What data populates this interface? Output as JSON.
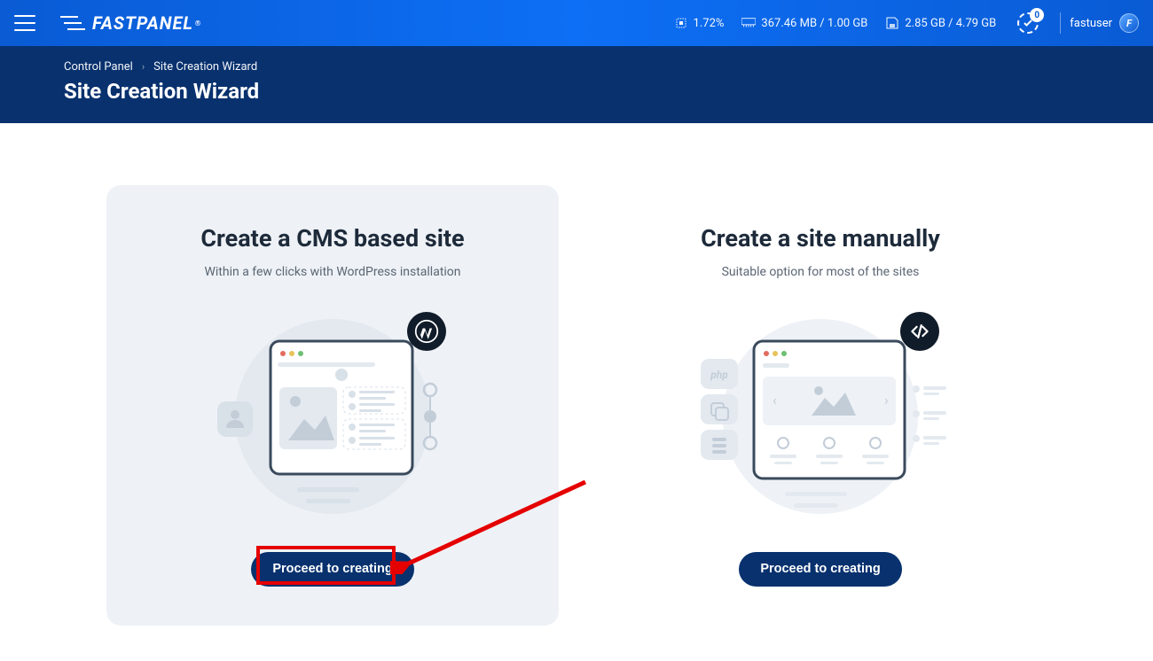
{
  "header": {
    "logo_text": "FASTPANEL",
    "stats": {
      "cpu": "1.72%",
      "ram": "367.46 MB / 1.00 GB",
      "disk": "2.85 GB / 4.79 GB"
    },
    "notifications_count": "0",
    "username": "fastuser",
    "avatar_letter": "F"
  },
  "breadcrumb": {
    "root": "Control Panel",
    "current": "Site Creation Wizard"
  },
  "page_title": "Site Creation Wizard",
  "cards": {
    "cms": {
      "title": "Create a CMS based site",
      "subtitle": "Within a few clicks with WordPress installation",
      "button": "Proceed to creating"
    },
    "manual": {
      "title": "Create a site manually",
      "subtitle": "Suitable option for most of the sites",
      "button": "Proceed to creating"
    }
  }
}
